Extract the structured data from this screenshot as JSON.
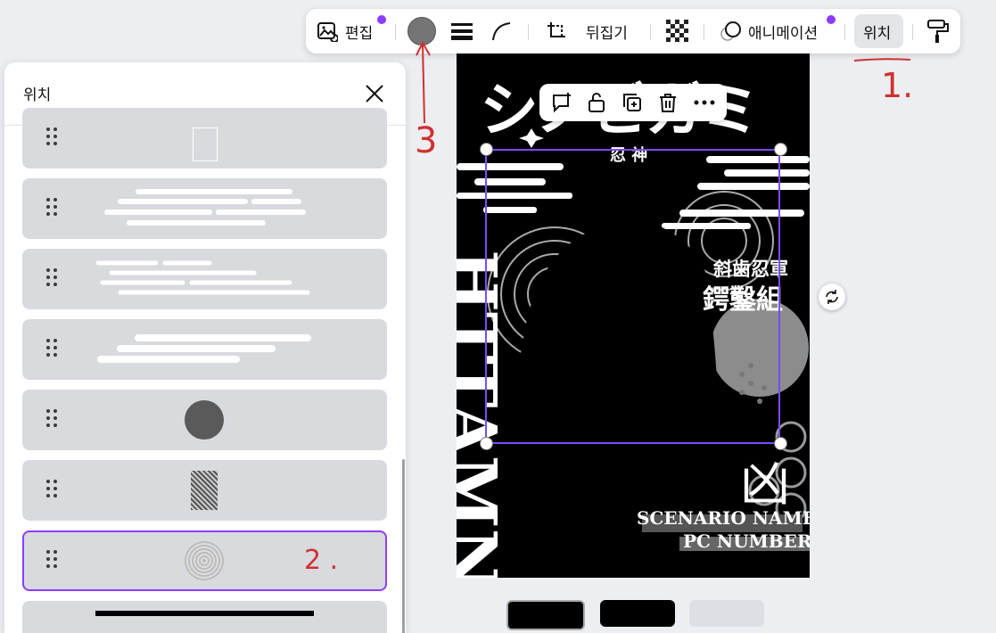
{
  "toolbar": {
    "edit_label": "편집",
    "flip_label": "뒤집기",
    "animation_label": "애니메이션",
    "position_label": "위치",
    "fill_color": "#757575",
    "accent": "#8b3dff"
  },
  "panel": {
    "title": "위치",
    "layers": [
      {
        "name": "layer-blank-rect",
        "icon": "rectangle-outline"
      },
      {
        "name": "layer-white-stripes-1",
        "icon": "stripes"
      },
      {
        "name": "layer-white-stripes-2",
        "icon": "stripes"
      },
      {
        "name": "layer-white-stripes-3",
        "icon": "stripes"
      },
      {
        "name": "layer-gray-circle",
        "icon": "circle",
        "color": "#5a5a5a"
      },
      {
        "name": "layer-dot-pattern",
        "icon": "halftone"
      },
      {
        "name": "layer-textured-circle",
        "icon": "circle-texture",
        "selected": true
      },
      {
        "name": "layer-black-bar",
        "icon": "bar"
      }
    ]
  },
  "canvas": {
    "title_katakana": "シノビガミ",
    "subtitle": "忍 神",
    "rank_line1": "斜歯忍軍",
    "rank_line2": "鍔鑿組",
    "kanji": "凶",
    "scenario": "SCENARIO NAME",
    "pc_number": "PC NUMBER",
    "vertical_text": "HTTAMNL"
  },
  "annotations": {
    "mark1": "1.",
    "mark2": "2 .",
    "mark3": "3"
  }
}
